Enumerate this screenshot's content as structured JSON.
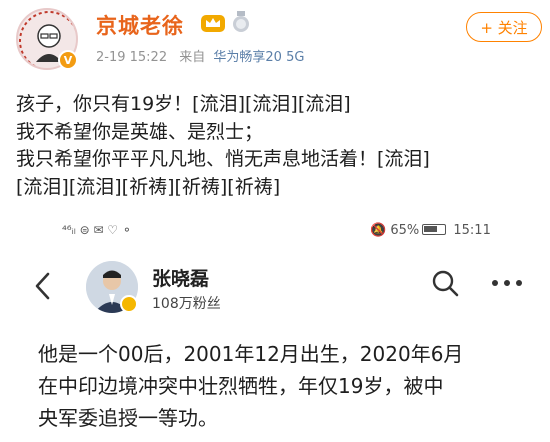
{
  "post": {
    "username": "京城老徐",
    "verified_badge_icon": "verified-v-icon",
    "badge_icons": [
      "crown-icon",
      "medal-icon"
    ],
    "date": "2-19 15:22",
    "source_prefix": "来自",
    "source_device": "华为畅享20 5G",
    "follow_label": "+ 关注",
    "text_lines": [
      "孩子，你只有19岁！[流泪][流泪][流泪]",
      "我不希望你是英雄、是烈士；",
      "我只希望你平平凡凡地、悄无声息地活着！[流泪]",
      "[流泪][流泪][祈祷][祈祷][祈祷]"
    ]
  },
  "screenshot": {
    "status_left": "⁴⁶ᵢₗ ⊜ ✉ ♡ ⚬",
    "status_battery": "65%",
    "status_time": "15:11",
    "profile_name": "张晓磊",
    "profile_fans": "108万粉丝",
    "text_lines": [
      "他是一个00后，2001年12月出生，2020年6月",
      "在中印边境冲突中壮烈牺牲，年仅19岁，被中",
      "央军委追授一等功。"
    ]
  },
  "colors": {
    "username": "#e8641b",
    "follow": "#ff8200",
    "meta": "#939393",
    "source": "#5b7fa8"
  }
}
